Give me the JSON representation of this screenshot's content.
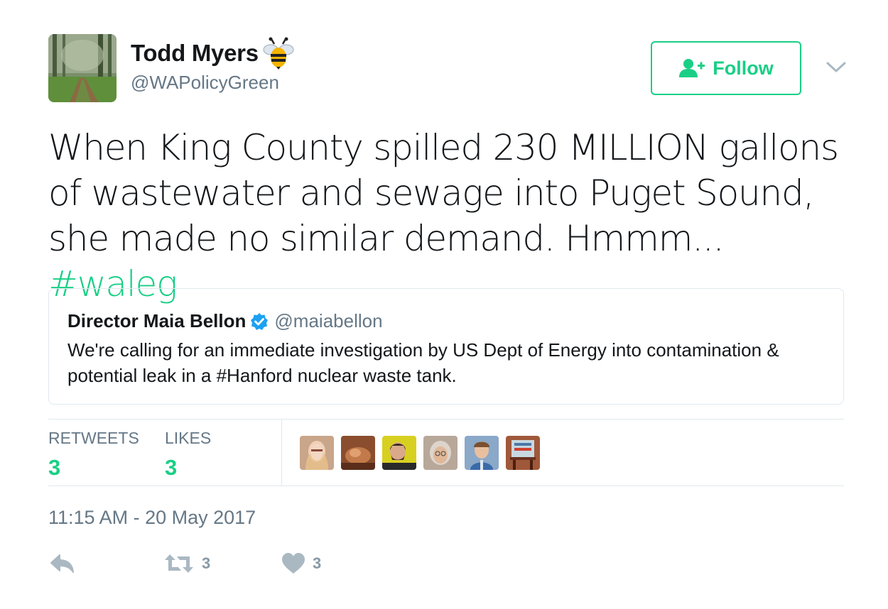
{
  "author": {
    "name": "Todd Myers",
    "handle": "@WAPolicyGreen",
    "avatar_icon": "forest-path-avatar",
    "emoji_icon": "bee-emoji"
  },
  "follow_button": {
    "label": "Follow",
    "icon": "add-user-icon"
  },
  "tweet": {
    "text": "When King County spilled 230 MILLION gallons of wastewater and sewage into Puget Sound, she made no similar demand. Hmmm... ",
    "hashtag": "#waleg"
  },
  "quoted_tweet": {
    "name": "Director Maia Bellon",
    "handle": "@maiabellon",
    "text": "We're calling for an immediate investigation by US Dept of Energy into contamination & potential leak in a #Hanford nuclear waste tank."
  },
  "stats": {
    "retweets_label": "RETWEETS",
    "retweets_count": "3",
    "likes_label": "LIKES",
    "likes_count": "3"
  },
  "timestamp": "11:15 AM - 20 May 2017",
  "actions": {
    "reply_icon": "reply-icon",
    "retweet_icon": "retweet-icon",
    "retweet_count": "3",
    "like_icon": "heart-icon",
    "like_count": "3"
  },
  "colors": {
    "accent": "#19cf86",
    "text": "#14171a",
    "muted": "#657786",
    "border": "#e1e8ed",
    "verified": "#1da1f2"
  }
}
